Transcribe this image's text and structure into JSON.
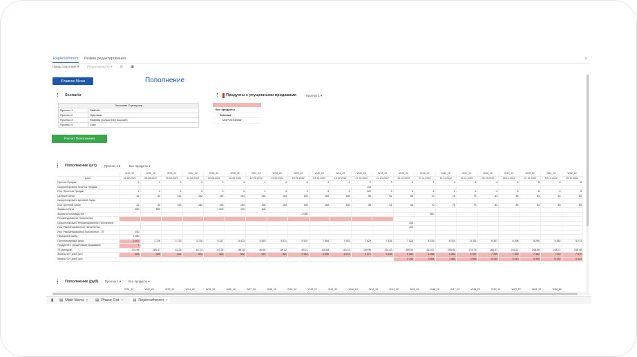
{
  "tabs": {
    "replenishment": "Replenishment",
    "edit_mode": "Режим редактирования"
  },
  "toolbar": {
    "view": "Представление ▾",
    "edit": "Редактировать ▾",
    "refresh_icon": "refresh-icon",
    "save_icon": "save-icon"
  },
  "main_menu_button": "ⅠГлавное Меню",
  "page_title": "Пополнение",
  "scenario": {
    "title": "Scenario",
    "header": "Описание Сценариев",
    "rows": [
      [
        "Прогноз 1",
        "Realistic"
      ],
      [
        "Прогноз 2",
        "Optimistic"
      ],
      [
        "Прогноз 3",
        "Realistic (только Key Account)"
      ],
      [
        "Прогноз 4",
        "Craft"
      ]
    ]
  },
  "calc_button": "Расчет Пополнения",
  "lost_sales": {
    "title": "Продукты с упущенными продажами",
    "dropdown": "Прогноз 1",
    "items": [
      "Все продукты",
      "Selected",
      "MDPDSS330W"
    ]
  },
  "replenishment_units": {
    "title": "Пополнение (шт)",
    "dd1": "Прогноз 1",
    "dd2": "Все продукты",
    "weeks": [
      "W31_22",
      "W32_22",
      "W33_22",
      "W34_22",
      "W35_22",
      "W36_22",
      "W37_22",
      "W38_22",
      "W39_22",
      "W40_22",
      "W41_22",
      "W42_22",
      "W43_22",
      "W44_22",
      "W45_22",
      "W46_22",
      "W47_22",
      "W48_22",
      "W49_22",
      "W50_22",
      "W51_22",
      "W52_22"
    ],
    "date_label": "Дата",
    "dates": [
      "01.08.2022",
      "08.08.2022",
      "15.08.2022",
      "22.08.2022",
      "29.08.2022",
      "05.09.2022",
      "12.09.2022",
      "19.09.2022",
      "26.09.2022",
      "03.10.2022",
      "10.10.2022",
      "17.10.2022",
      "24.10.2022",
      "31.10.2022",
      "07.11.2022",
      "14.11.2022",
      "21.11.2022",
      "28.11.2022",
      "05.12.2022",
      "12.12.2022",
      "19.12.2022",
      "26.12.2022"
    ],
    "rows": [
      {
        "label": "Прогноз Продаж",
        "values": [
          "2",
          "3",
          "3",
          "3",
          "3",
          "4",
          "4",
          "4",
          "4",
          "3",
          "3",
          "2",
          "3",
          "3",
          "4",
          "4",
          "4",
          "4",
          "8",
          "8",
          "8",
          "8"
        ]
      },
      {
        "label": "Скорректировать Прогноз Продаж",
        "values": [
          "",
          "",
          "",
          "",
          "",
          "",
          "",
          "",
          "",
          "",
          "",
          "115",
          "",
          "",
          "",
          "",
          "",
          "",
          "",
          "",
          "",
          ""
        ]
      },
      {
        "label": "Итог Прогноза Продаж",
        "values": [
          "2",
          "3",
          "3",
          "3",
          "3",
          "4",
          "4",
          "4",
          "4",
          "3",
          "3",
          "122",
          "3",
          "3",
          "4",
          "4",
          "4",
          "4",
          "8",
          "8",
          "8",
          "8"
        ]
      },
      {
        "label": "Целевой Запас",
        "values": [
          "32",
          "33",
          "152",
          "152",
          "152",
          "154",
          "154",
          "154",
          "159",
          "164",
          "165",
          "56",
          "61",
          "66",
          "70",
          "75",
          "79",
          "83",
          "83",
          "83",
          "83",
          "83"
        ]
      },
      {
        "label": "Скорректировать Целевой Запас",
        "values": [
          "",
          "",
          "",
          "",
          "",
          "",
          "",
          "",
          "",
          "",
          "",
          "",
          "",
          "",
          "",
          "",
          "",
          "",
          "",
          "",
          "",
          ""
        ]
      },
      {
        "label": "Итог Целевой Запас",
        "values": [
          "32",
          "33",
          "152",
          "152",
          "152",
          "154",
          "154",
          "154",
          "159",
          "164",
          "165",
          "56",
          "61",
          "66",
          "70",
          "75",
          "79",
          "83",
          "83",
          "83",
          "83",
          "83"
        ]
      },
      {
        "label": "Заказы в Пути",
        "values": [
          "650",
          "800",
          "",
          "",
          "1 600",
          "100",
          "105",
          "",
          "",
          "",
          "",
          "",
          "",
          "",
          "",
          "",
          "",
          "",
          "",
          "",
          "",
          ""
        ]
      },
      {
        "label": "Заказы в производстве",
        "values": [
          "",
          "",
          "",
          "",
          "",
          "",
          "",
          "",
          "2 050",
          "",
          "",
          "",
          "",
          "",
          "800",
          "",
          "",
          "",
          "",
          "",
          "",
          ""
        ]
      },
      {
        "label": "Рекомендованное Пополнение",
        "values": [
          "",
          "",
          "",
          "",
          "",
          "",
          "",
          "",
          "",
          "",
          "",
          "",
          "",
          "",
          "",
          "",
          "",
          "",
          "",
          "",
          "",
          ""
        ]
      },
      {
        "label": "Скорректировать Рекомендованное Пополнение",
        "values": [
          "",
          "",
          "",
          "",
          "",
          "",
          "",
          "",
          "",
          "",
          "",
          "",
          "",
          "100",
          "",
          "",
          "",
          "",
          "",
          "",
          "",
          ""
        ]
      },
      {
        "label": "Итог Рекомендованного Пополнения",
        "values": [
          "",
          "",
          "",
          "",
          "",
          "",
          "",
          "",
          "",
          "",
          "",
          "",
          "",
          "100",
          "",
          "",
          "",
          "",
          "",
          "",
          "",
          ""
        ]
      },
      {
        "label": "Итог Рекомендованное Пополнение - ЛТ",
        "values": [
          "100",
          "",
          "",
          "",
          "",
          "",
          "",
          "",
          "",
          "",
          "",
          "",
          "",
          "",
          "",
          "",
          "",
          "",
          "",
          "",
          "",
          ""
        ]
      },
      {
        "label": "Начальный запас",
        "values": [
          "1 980",
          "",
          "",
          "",
          "",
          "",
          "",
          "",
          "",
          "",
          "",
          "",
          "",
          "",
          "",
          "",
          "",
          "",
          "",
          "",
          "",
          ""
        ]
      },
      {
        "label": "Прогнозируемый запас",
        "values": [
          "2 927",
          "3 726",
          "3 723",
          "3 720",
          "5 317",
          "5 413",
          "5 515",
          "5 511",
          "5 507",
          "7 554",
          "7 551",
          "7 429",
          "7 426",
          "7 523",
          "8 319",
          "8 315",
          "8 311",
          "8 307",
          "8 298",
          "8 290",
          "8 282",
          "8 273"
        ]
      },
      {
        "label": "Продуктов с упущенными продажами",
        "values": [
          "1",
          "",
          "",
          "",
          "",
          "",
          "",
          "",
          "",
          "",
          "",
          "",
          "",
          "",
          "",
          "",
          "",
          "",
          "",
          "",
          "",
          ""
        ]
      },
      {
        "label": "ТЗ (доходов)",
        "values": [
          "223.98",
          "285.47",
          "61.25",
          "61.14",
          "87.24",
          "88.15",
          "89.64",
          "89.42",
          "89.21",
          "118.84",
          "115.01",
          "109.96",
          "234.03",
          "359.54",
          "313.02",
          "295.65",
          "278.79",
          "263.07",
          "249.21",
          "248.56",
          "248.71",
          "248.46"
        ]
      },
      {
        "label": "Запасы 60+ дней (шт)",
        "values": [
          "523",
          "523",
          "522",
          "522",
          "522",
          "522",
          "521",
          "521",
          "2 914",
          "3 696",
          "3 574",
          "3 571",
          "5 168",
          "5 264",
          "4 965",
          "5 361",
          "5 357",
          "7 399",
          "7 390",
          "7 382",
          "7 378",
          "7 370"
        ]
      },
      {
        "label": "Запасы 90+ дней (шт)",
        "values": [
          "",
          "",
          "",
          "",
          "",
          "",
          "",
          "",
          "",
          "",
          "",
          "",
          "",
          "2 783",
          "3 564",
          "3 560",
          "3 556",
          "5 152",
          "5 243",
          "5 340",
          "5 332",
          "5 323"
        ]
      }
    ]
  },
  "replenishment_rub": {
    "title": "Пополнение (руб)",
    "dd1": "Прогноз 1",
    "dd2": "Все продукты",
    "weeks": [
      "W31_22",
      "W32_22",
      "W33_22",
      "W34_22",
      "W35_22",
      "W36_22",
      "W37_22",
      "W38_22",
      "W39_22",
      "W40_22",
      "W41_22",
      "W42_22",
      "W43_22",
      "W44_22",
      "W45_22",
      "W46_22",
      "W47_22",
      "W48_22",
      "W49_22",
      "W50_22",
      "W51_22",
      "W52_22"
    ]
  },
  "bottom_tabs": [
    {
      "label": "Main Menu",
      "icon": "page-icon"
    },
    {
      "label": "Phase Out",
      "icon": "page-icon"
    },
    {
      "label": "Replenishment",
      "icon": "page-icon"
    }
  ],
  "colors": {
    "accent_blue": "#1e56a8",
    "green": "#3aa54a",
    "pink": "#f4b6b3"
  }
}
